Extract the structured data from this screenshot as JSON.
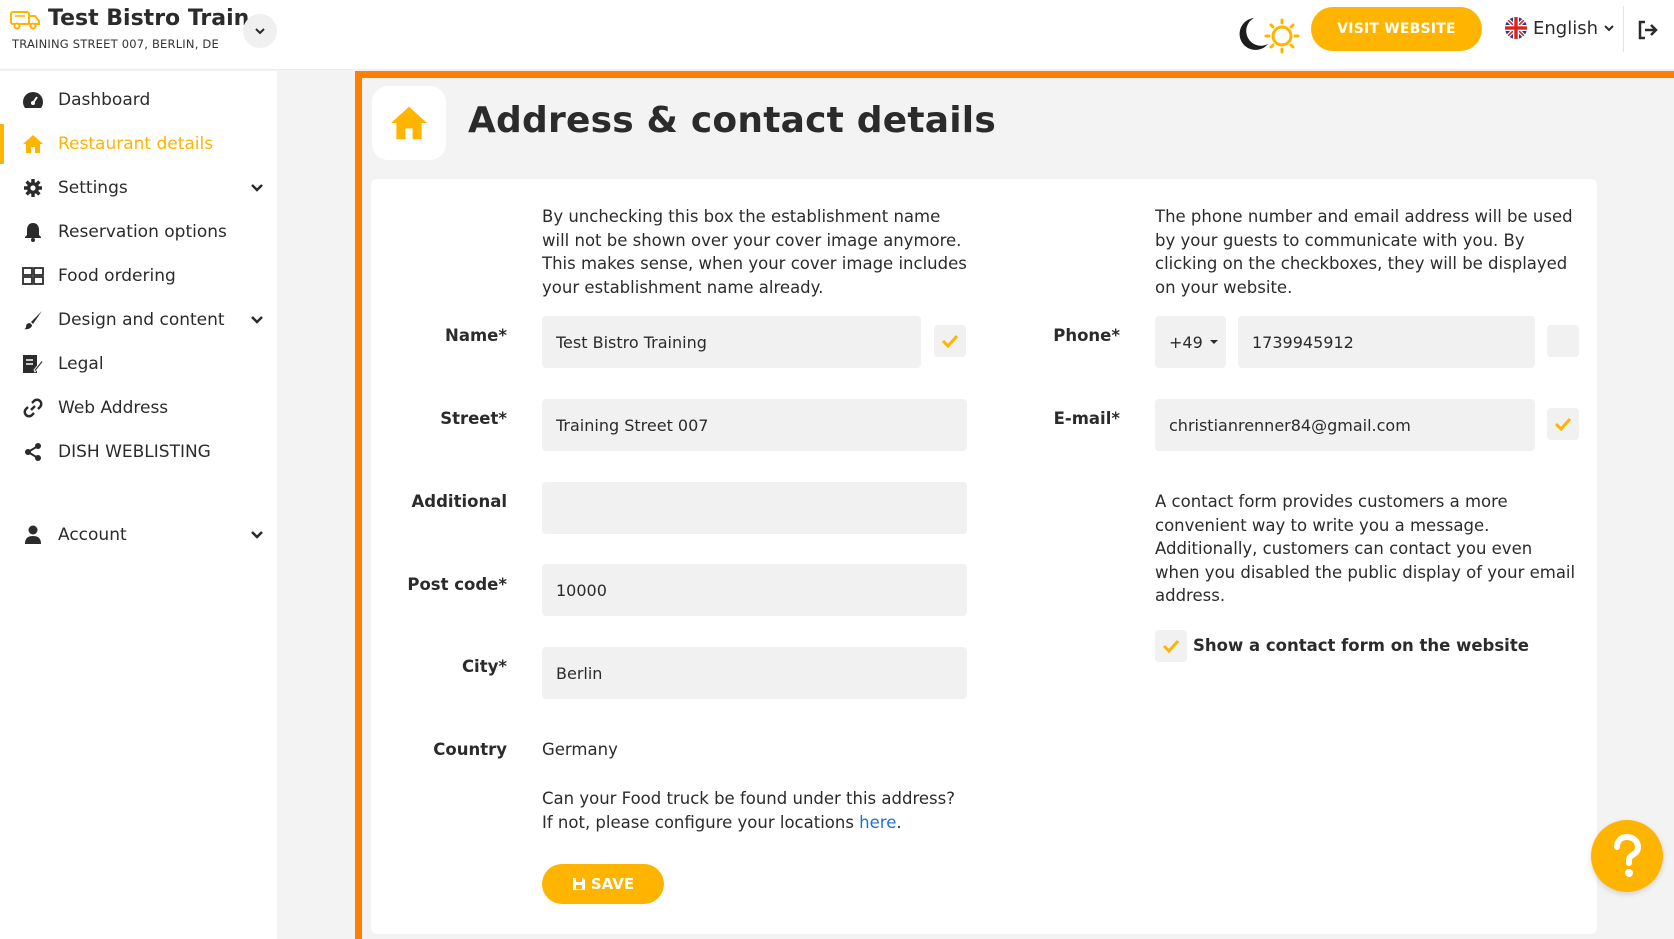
{
  "brand": {
    "title": "Test Bistro Train...",
    "subtitle": "TRAINING STREET 007, BERLIN, DE"
  },
  "header": {
    "visit_website": "VISIT WEBSITE",
    "language": "English"
  },
  "sidebar": {
    "items": [
      {
        "label": "Dashboard",
        "icon": "dashboard-icon"
      },
      {
        "label": "Restaurant details",
        "icon": "home-icon",
        "active": true
      },
      {
        "label": "Settings",
        "icon": "gear-icon",
        "expandable": true
      },
      {
        "label": "Reservation options",
        "icon": "bell-icon"
      },
      {
        "label": "Food ordering",
        "icon": "food-ordering-icon"
      },
      {
        "label": "Design and content",
        "icon": "brush-icon",
        "expandable": true
      },
      {
        "label": "Legal",
        "icon": "legal-icon"
      },
      {
        "label": "Web Address",
        "icon": "link-icon"
      },
      {
        "label": "DISH WEBLISTING",
        "icon": "share-icon"
      },
      {
        "label": "Account",
        "icon": "user-icon",
        "expandable": true
      }
    ]
  },
  "page": {
    "title": "Address & contact details"
  },
  "left": {
    "note": "By unchecking this box the establishment name will not be shown over your cover image anymore. This makes sense, when your cover image includes your establishment name already.",
    "name_label": "Name*",
    "name_value": "Test Bistro Training",
    "name_checked": true,
    "street_label": "Street*",
    "street_value": "Training Street 007",
    "additional_label": "Additional",
    "additional_value": "",
    "postcode_label": "Post code*",
    "postcode_value": "10000",
    "city_label": "City*",
    "city_value": "Berlin",
    "country_label": "Country",
    "country_value": "Germany",
    "foodtruck_line1": "Can your Food truck be found under this address?",
    "foodtruck_line2": "If not, please configure your locations ",
    "foodtruck_link": "here",
    "foodtruck_end": ".",
    "save_label": "SAVE"
  },
  "right": {
    "note": "The phone number and email address will be used by your guests to communicate with you. By clicking on the checkboxes, they will be displayed on your website.",
    "phone_label": "Phone*",
    "phone_code": "+49",
    "phone_value": "1739945912",
    "phone_checked": false,
    "email_label": "E-mail*",
    "email_value": "christianrenner84@gmail.com",
    "email_checked": true,
    "contact_note": "A contact form provides customers a more convenient way to write you a message. Additionally, customers can contact you even when you disabled the public display of your email address.",
    "contact_form_label": "Show a contact form on the website",
    "contact_form_checked": true
  },
  "colors": {
    "accent": "#ffb400",
    "frame": "#ff7f00",
    "link": "#1f74c8"
  }
}
